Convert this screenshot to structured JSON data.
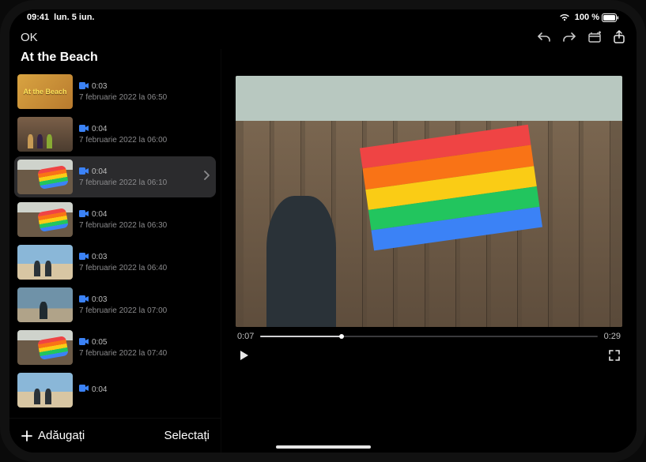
{
  "status": {
    "time": "09:41",
    "date": "lun. 5 iun.",
    "battery": "100 %"
  },
  "toolbar": {
    "ok": "OK"
  },
  "project": {
    "title": "At the Beach"
  },
  "clips": [
    {
      "thumbCls": "tart-title",
      "thumbText": "At the Beach",
      "duration": "0:03",
      "date": "7 februarie 2022 la 06:50",
      "selected": false
    },
    {
      "thumbCls": "tart-people",
      "duration": "0:04",
      "date": "7 februarie 2022 la 06:00",
      "selected": false
    },
    {
      "thumbCls": "tart-kite",
      "duration": "0:04",
      "date": "7 februarie 2022 la 06:10",
      "selected": true
    },
    {
      "thumbCls": "tart-kite",
      "duration": "0:04",
      "date": "7 februarie 2022 la 06:30",
      "selected": false
    },
    {
      "thumbCls": "tart-beach",
      "duration": "0:03",
      "date": "7 februarie 2022 la 06:40",
      "selected": false
    },
    {
      "thumbCls": "tart-run",
      "duration": "0:03",
      "date": "7 februarie 2022 la 07:00",
      "selected": false
    },
    {
      "thumbCls": "tart-kite",
      "duration": "0:05",
      "date": "7 februarie 2022 la 07:40",
      "selected": false
    },
    {
      "thumbCls": "tart-beach",
      "duration": "0:04",
      "date": "",
      "selected": false
    }
  ],
  "sidebarFooter": {
    "add": "Adăugați",
    "select": "Selectați"
  },
  "player": {
    "current": "0:07",
    "total": "0:29",
    "progressPct": 24
  }
}
